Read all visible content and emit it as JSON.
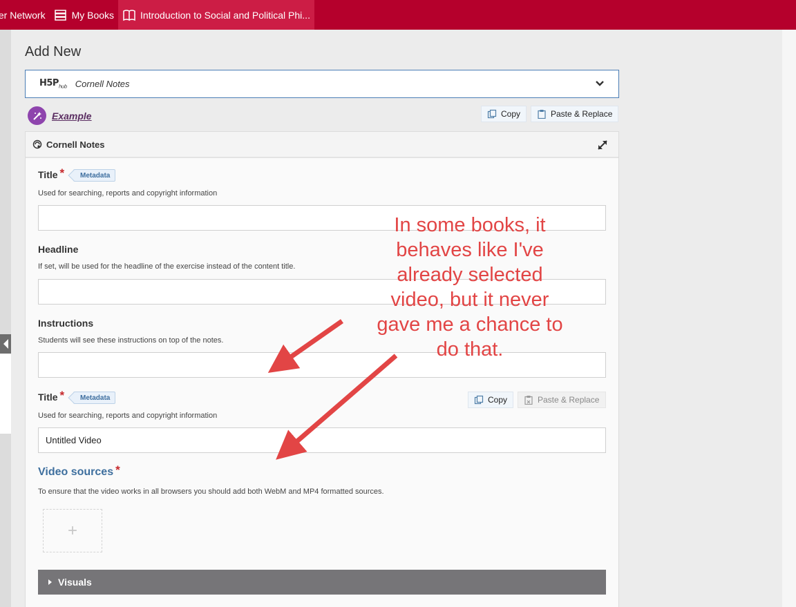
{
  "topbar": {
    "network_label": "ter Network",
    "mybooks_label": "My Books",
    "book_title": "Introduction to Social and Political Phi..."
  },
  "page": {
    "title": "Add New"
  },
  "selector": {
    "logo_text": "H5P",
    "logo_sub": "hub",
    "content_type": "Cornell Notes"
  },
  "example": {
    "label": "Example"
  },
  "top_buttons": {
    "copy": "Copy",
    "paste": "Paste & Replace"
  },
  "panel": {
    "title": "Cornell Notes"
  },
  "fields": {
    "title": {
      "label": "Title",
      "meta": "Metadata",
      "desc": "Used for searching, reports and copyright information",
      "value": ""
    },
    "headline": {
      "label": "Headline",
      "desc": "If set, will be used for the headline of the exercise instead of the content title.",
      "value": ""
    },
    "instructions": {
      "label": "Instructions",
      "desc": "Students will see these instructions on top of the notes.",
      "value": ""
    },
    "video_title": {
      "label": "Title",
      "meta": "Metadata",
      "desc": "Used for searching, reports and copyright information",
      "value": "Untitled Video"
    }
  },
  "video_buttons": {
    "copy": "Copy",
    "paste": "Paste & Replace"
  },
  "video_sources": {
    "label": "Video sources",
    "desc": "To ensure that the video works in all browsers you should add both WebM and MP4 formatted sources.",
    "add_symbol": "+"
  },
  "visuals": {
    "label": "Visuals"
  },
  "annotation": {
    "lines": [
      "In some books, it",
      "behaves like I've",
      "already selected",
      "video, but it never",
      "gave me a chance to",
      "do that."
    ],
    "color": "#e24545"
  },
  "colors": {
    "topbar": "#b5002c",
    "topbar_active": "#cc1d45",
    "accent": "#3e6f9e",
    "required": "#c6282b"
  }
}
